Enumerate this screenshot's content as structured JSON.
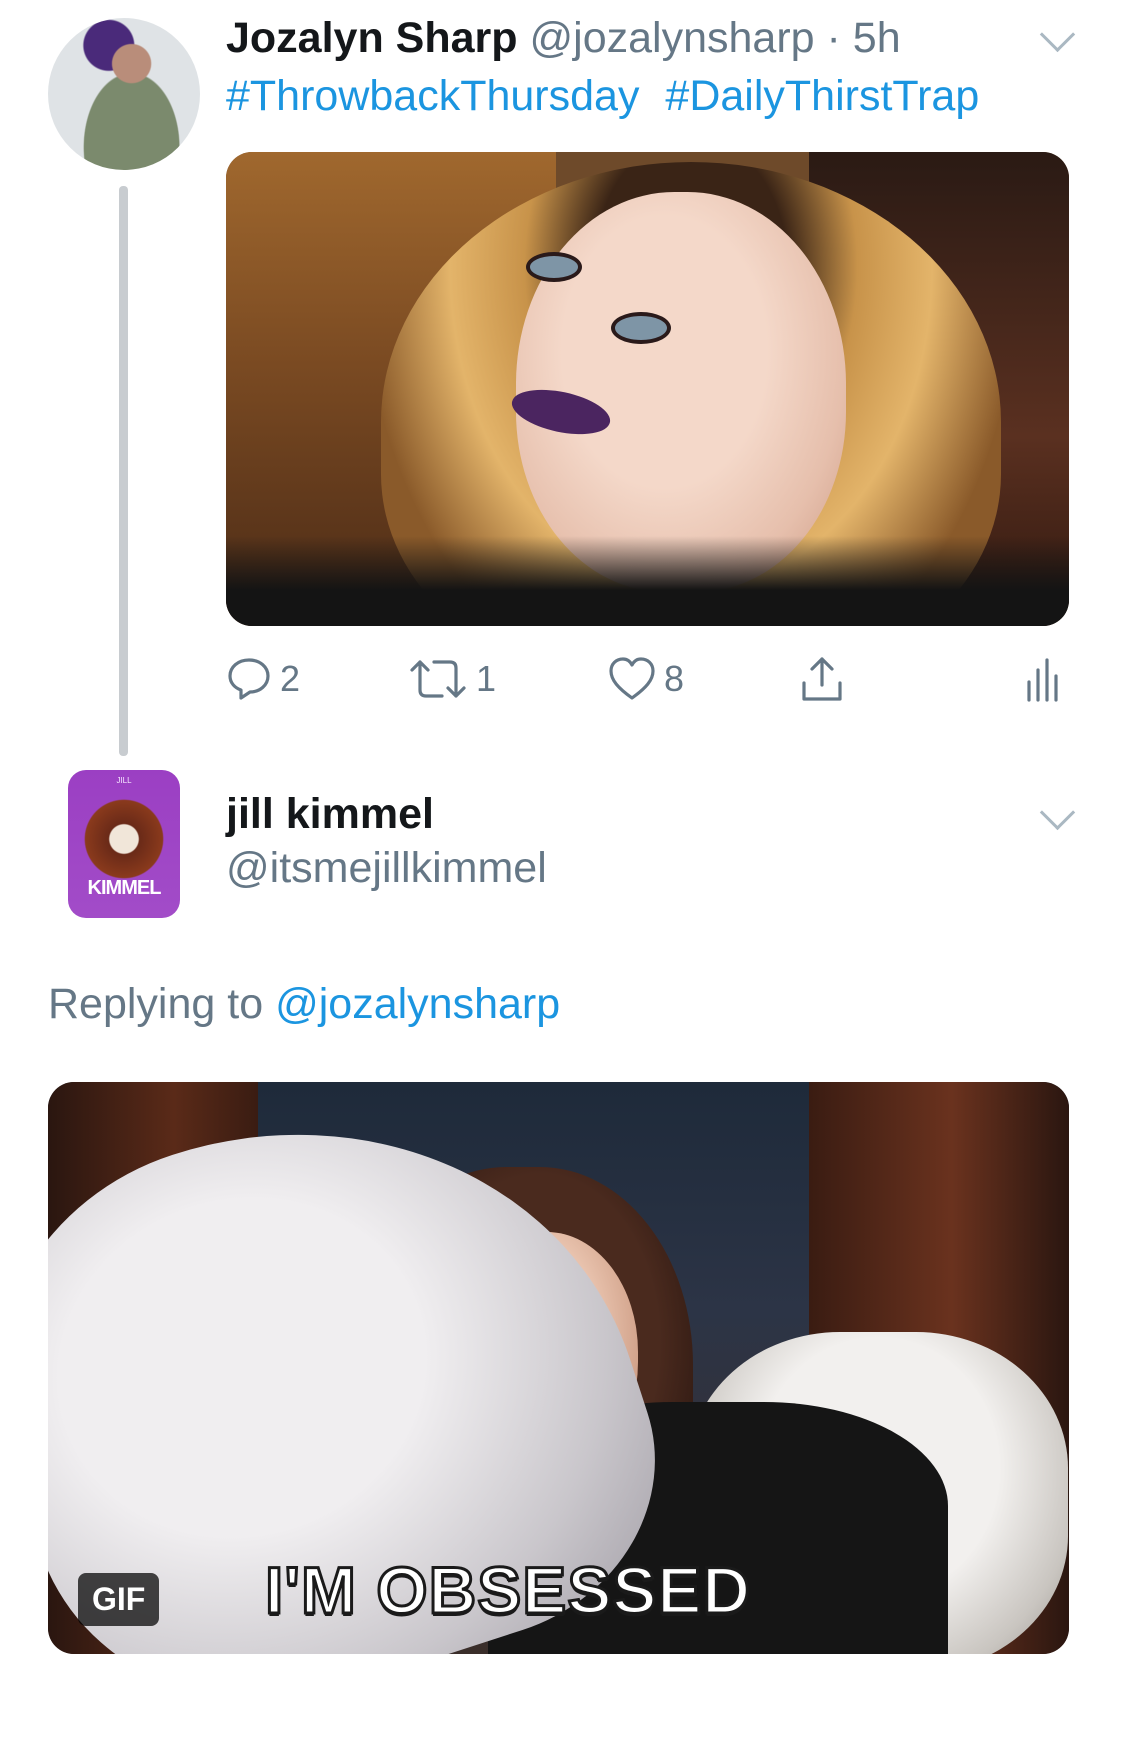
{
  "tweet1": {
    "author_name": "Jozalyn Sharp",
    "author_handle": "@jozalynsharp",
    "separator": "·",
    "time": "5h",
    "hashtags": [
      "#ThrowbackThursday",
      "#DailyThirstTrap"
    ],
    "actions": {
      "reply_count": "2",
      "retweet_count": "1",
      "like_count": "8"
    },
    "icons": [
      "reply-icon",
      "retweet-icon",
      "like-icon",
      "share-icon",
      "analytics-icon",
      "chevron-down-icon"
    ]
  },
  "tweet2": {
    "author_name": "jill kimmel",
    "author_handle": "@itsmejillkimmel",
    "avatar_text": "KIMMEL",
    "avatar_small_text": "JILL",
    "replying_prefix": "Replying to",
    "replying_handle": "@jozalynsharp",
    "gif_badge": "GIF",
    "gif_caption": "I'M OBSESSED"
  },
  "colors": {
    "link_blue": "#1b95e0",
    "secondary_gray": "#657786",
    "thread_line": "#c8ccd0",
    "avatar_purple": "#9b3fc3"
  }
}
